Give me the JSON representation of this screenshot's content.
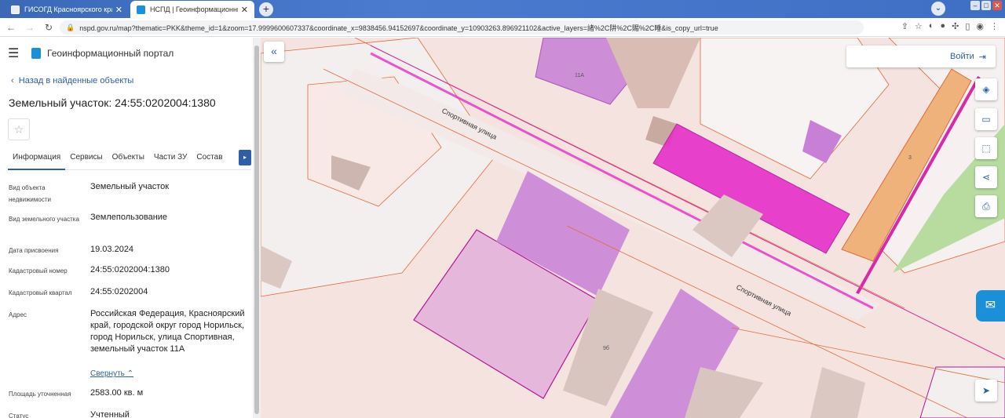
{
  "browser": {
    "tabs": [
      {
        "title": "ГИСОГД Красноярского края",
        "favicon_color": "#3b6fbf"
      },
      {
        "title": "НСПД | Геоинформационный п...",
        "favicon_color": "#1c8fd9"
      }
    ],
    "url": "nspd.gov.ru/map?thematic=PKK&theme_id=1&zoom=17.9999600607337&coordinate_x=9838456.94152697&coordinate_y=10903263.896921102&active_layers=諸%2C阱%2C賜%2C睡&is_copy_url=true"
  },
  "sidebar": {
    "portal_title": "Геоинформационный портал",
    "back_link": "Назад в найденные объекты",
    "parcel_title": "Земельный участок: 24:55:0202004:1380",
    "tabs": [
      "Информация",
      "Сервисы",
      "Объекты",
      "Части ЗУ",
      "Состав"
    ],
    "attributes": [
      {
        "label": "Вид объекта недвижимости",
        "value": "Земельный участок"
      },
      {
        "label": "Вид земельного участка",
        "value": "Землепользование"
      },
      {
        "label": "Дата присвоения",
        "value": "19.03.2024"
      },
      {
        "label": "Кадастровый номер",
        "value": "24:55:0202004:1380"
      },
      {
        "label": "Кадастровый квартал",
        "value": "24:55:0202004"
      },
      {
        "label": "Адрес",
        "value": "Российская Федерация, Красноярский край, городской округ город Норильск, город Норильск, улица Спортивная, земельный участок 11А"
      },
      {
        "label": "Площадь уточненная",
        "value": "2583.00 кв. м"
      },
      {
        "label": "Статус",
        "value": "Учтенный"
      }
    ],
    "collapse_link": "Свернуть"
  },
  "map": {
    "login_label": "Войти",
    "street_label_1": "Спортивная улица",
    "street_label_2": "Спортивная улица",
    "number_label_1": "11А",
    "number_label_2": "9б",
    "number_label_3": "3",
    "colors": {
      "background": "#f5e3e0",
      "parcel_line": "#e06a3c",
      "highlight": "#e62fc8",
      "building": "#c87fd6",
      "orange_zone": "#eeb27a",
      "green": "#b8dca0"
    }
  }
}
